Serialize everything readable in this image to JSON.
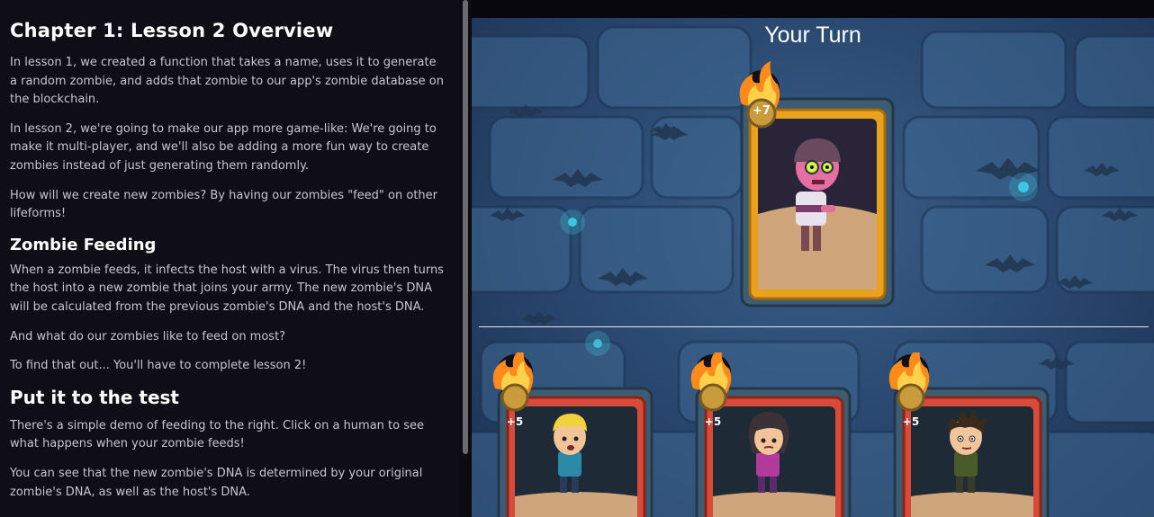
{
  "lesson": {
    "title": "Chapter 1: Lesson 2 Overview",
    "p1": "In lesson 1, we created a function that takes a name, uses it to generate a random zombie, and adds that zombie to our app's zombie database on the blockchain.",
    "p2": "In lesson 2, we're going to make our app more game-like: We're going to make it multi-player, and we'll also be adding a more fun way to create zombies instead of just generating them randomly.",
    "p3": "How will we create new zombies? By having our zombies \"feed\" on other lifeforms!",
    "section1_title": "Zombie Feeding",
    "p4": "When a zombie feeds, it infects the host with a virus. The virus then turns the host into a new zombie that joins your army. The new zombie's DNA will be calculated from the previous zombie's DNA and the host's DNA.",
    "p5": "And what do our zombies like to feed on most?",
    "p6": "To find that out... You'll have to complete lesson 2!",
    "section2_title": "Put it to the test",
    "p7": "There's a simple demo of feeding to the right. Click on a human to see what happens when your zombie feeds!",
    "p8": "You can see that the new zombie's DNA is determined by your original zombie's DNA, as well as the host's DNA."
  },
  "game": {
    "turn_title": "Your Turn",
    "zombie_card": {
      "level": "+7",
      "character": "zombie"
    },
    "human_cards": [
      {
        "level": "+5",
        "character": "blond-human"
      },
      {
        "level": "+5",
        "character": "dark-hair-girl"
      },
      {
        "level": "+5",
        "character": "brown-hair-boy"
      }
    ],
    "colors": {
      "zombie_frame": "#e8a21c",
      "human_frame": "#d84a3a",
      "card_outer": "#3c5c72",
      "badge": "#c99b3a",
      "flame": "#ff8a1c"
    }
  }
}
